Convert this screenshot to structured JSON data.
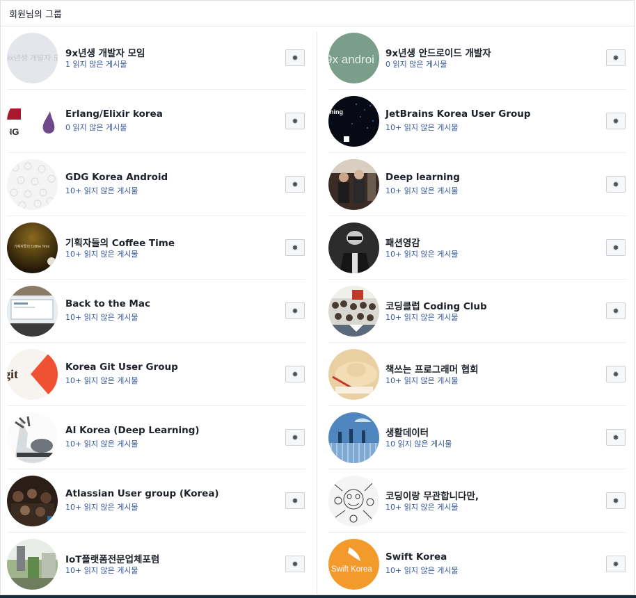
{
  "header": {
    "title": "회원님의 그룹"
  },
  "icons": {
    "settings": "gear-icon"
  },
  "colors": {
    "link": "#365899",
    "border": "#dddfe2"
  },
  "left_groups": [
    {
      "name": "9x년생 개발자 모임",
      "unread_count": "1",
      "unread_text": " 읽지 않은 게시물",
      "cover_text": "9x년생 개발자 모임"
    },
    {
      "name": "Erlang/Elixir korea",
      "unread_count": "0",
      "unread_text": " 읽지 않은 게시물",
      "cover_text": "NG"
    },
    {
      "name": "GDG Korea Android",
      "unread_count": "10+",
      "unread_text": " 읽지 않은 게시물",
      "cover_text": ""
    },
    {
      "name": "기획자들의 Coffee Time",
      "unread_count": "10+",
      "unread_text": " 읽지 않은 게시물",
      "cover_text": "기획자들의 Coffee Time"
    },
    {
      "name": "Back to the Mac",
      "unread_count": "10+",
      "unread_text": " 읽지 않은 게시물",
      "cover_text": ""
    },
    {
      "name": "Korea Git User Group",
      "unread_count": "10+",
      "unread_text": " 읽지 않은 게시물",
      "cover_text": "git"
    },
    {
      "name": "AI Korea (Deep Learning)",
      "unread_count": "10+",
      "unread_text": " 읽지 않은 게시물",
      "cover_text": ""
    },
    {
      "name": "Atlassian User group (Korea)",
      "unread_count": "10+",
      "unread_text": " 읽지 않은 게시물",
      "cover_text": ""
    },
    {
      "name": "IoT플랫폼전문업체포럼",
      "unread_count": "10+",
      "unread_text": " 읽지 않은 게시물",
      "cover_text": ""
    }
  ],
  "right_groups": [
    {
      "name": "9x년생 안드로이드 개발자",
      "unread_count": "0",
      "unread_text": " 읽지 않은 게시물",
      "cover_text": "9x androi"
    },
    {
      "name": "JetBrains Korea User Group",
      "unread_count": "10+",
      "unread_text": " 읽지 않은 게시물",
      "cover_text": "ning"
    },
    {
      "name": "Deep learning",
      "unread_count": "10+",
      "unread_text": " 읽지 않은 게시물",
      "cover_text": ""
    },
    {
      "name": "패션영감",
      "unread_count": "10+",
      "unread_text": " 읽지 않은 게시물",
      "cover_text": ""
    },
    {
      "name": "코딩클럽 Coding Club",
      "unread_count": "10+",
      "unread_text": " 읽지 않은 게시물",
      "cover_text": ""
    },
    {
      "name": "책쓰는 프로그래머 협회",
      "unread_count": "10+",
      "unread_text": " 읽지 않은 게시물",
      "cover_text": ""
    },
    {
      "name": "생활데이터",
      "unread_count": "10",
      "unread_text": " 읽지 않은 게시물",
      "cover_text": ""
    },
    {
      "name": "코딩이랑 무관합니다만,",
      "unread_count": "10+",
      "unread_text": " 읽지 않은 게시물",
      "cover_text": ""
    },
    {
      "name": "Swift Korea",
      "unread_count": "10+",
      "unread_text": " 읽지 않은 게시물",
      "cover_text": "Swift Korea"
    }
  ]
}
